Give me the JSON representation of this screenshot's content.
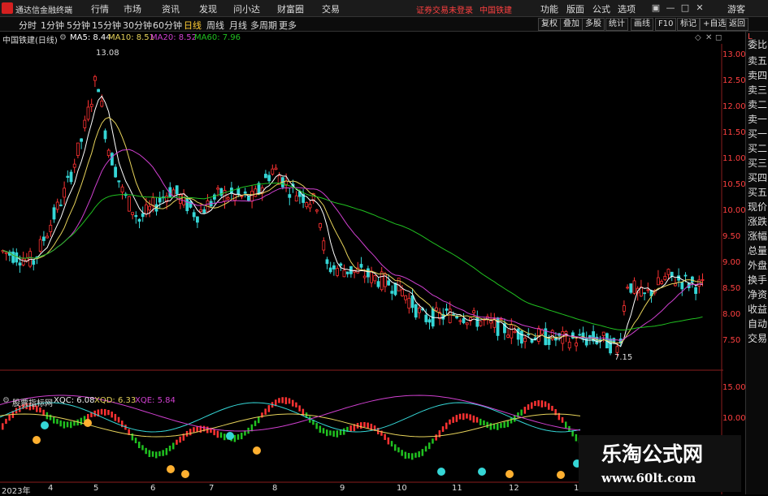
{
  "app": {
    "title": "通达信金融终端"
  },
  "menu": [
    "行情",
    "市场",
    "资讯",
    "发现",
    "问小达",
    "财富圈",
    "交易"
  ],
  "alert": {
    "text": "证券交易未登录",
    "stock": "中国铁建"
  },
  "right_menu": [
    "功能",
    "版面",
    "公式",
    "选项",
    "游客"
  ],
  "periods": [
    "分时",
    "1分钟",
    "5分钟",
    "15分钟",
    "30分钟",
    "60分钟",
    "日线",
    "周线",
    "月线",
    "多周期",
    "更多"
  ],
  "active_period": "日线",
  "tools": [
    "复权",
    "叠加",
    "多股",
    "统计",
    "画线",
    "F10",
    "标记",
    "+自选",
    "返回"
  ],
  "stock": {
    "label": "中国铁建(日线)"
  },
  "ma": {
    "ma5": "MA5: 8.44",
    "ma10": "MA10: 8.51",
    "ma20": "MA20: 8.52",
    "ma60": "MA60: 7.96"
  },
  "price_axis": [
    "13.00",
    "12.50",
    "12.00",
    "11.50",
    "11.00",
    "10.50",
    "10.00",
    "9.50",
    "9.00",
    "8.50",
    "8.00",
    "7.50"
  ],
  "annotations": {
    "high": "13.08",
    "low": "7.15"
  },
  "indicator": {
    "name": "股票指标网",
    "xqc": "XQC: 6.08",
    "xqd": "XQD: 6.33",
    "xqe": "XQE: 5.84",
    "axis": [
      "15.00",
      "10.00"
    ]
  },
  "months": [
    "2023年",
    "4",
    "5",
    "6",
    "7",
    "8",
    "9",
    "10",
    "11",
    "12",
    "1"
  ],
  "side": [
    "委比",
    "卖五",
    "卖四",
    "卖三",
    "卖二",
    "卖一",
    "买一",
    "买二",
    "买三",
    "买四",
    "买五",
    "现价",
    "涨跌",
    "涨幅",
    "总量",
    "外盘",
    "换手",
    "净资",
    "收益",
    "自动",
    "交易"
  ],
  "watermark": {
    "title": "乐淘公式网",
    "url": "www.60lt.com"
  },
  "colors": {
    "up": "#ff3232",
    "down": "#35d6d6",
    "ma5": "#ffffff",
    "ma10": "#e6d25a",
    "ma20": "#d040d0",
    "ma60": "#20c020"
  }
}
